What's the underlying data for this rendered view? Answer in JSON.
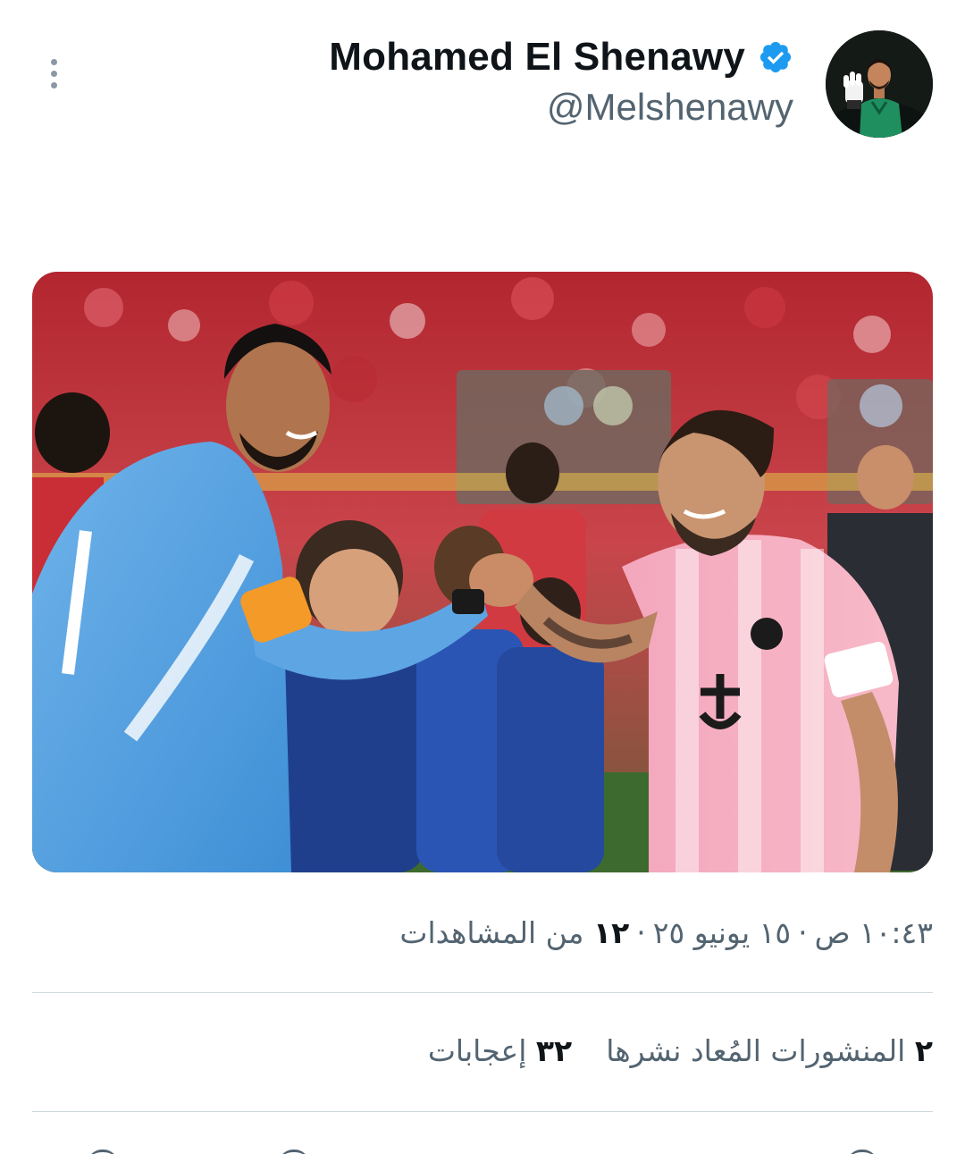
{
  "tweet": {
    "author": {
      "display_name": "Mohamed El Shenawy",
      "handle": "@Melshenawy",
      "verified": true,
      "avatar_icon": "profile-photo"
    },
    "media": {
      "kind": "photo"
    },
    "meta": {
      "time": "١٠:٤٣ ص",
      "date": "١٥ يونيو ٢٥",
      "views_count": "١٢",
      "views_label": "من المشاهدات",
      "separator": "·"
    },
    "stats": {
      "reposts_count": "٢",
      "reposts_label": "المنشورات المُعاد نشرها",
      "likes_count": "٣٢",
      "likes_label": "إعجابات"
    }
  },
  "colors": {
    "text_primary": "#0f1419",
    "text_secondary": "#536471",
    "verified_blue": "#1d9bf0",
    "divider": "#cfd9de"
  }
}
